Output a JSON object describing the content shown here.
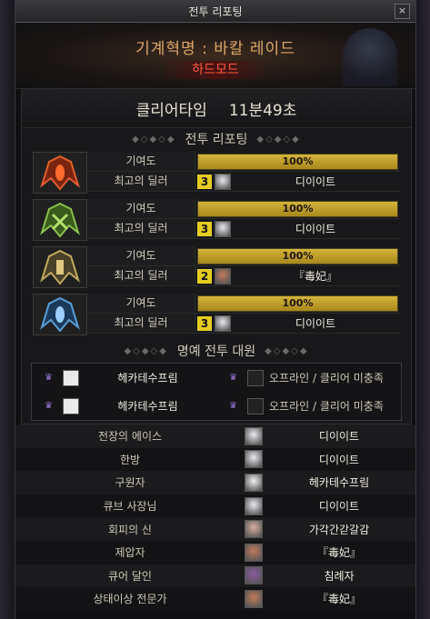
{
  "window": {
    "title": "전투 리포팅",
    "close_label": "×"
  },
  "banner": {
    "raid_name": "기계혁명 : 바칼 레이드",
    "mode": "하드모드"
  },
  "clear": {
    "label": "클리어타임",
    "time": "11분49초"
  },
  "report_section": {
    "title": "전투 리포팅",
    "ornament": "◆◇◆◇◆"
  },
  "contribution_rows": [
    {
      "emblem": "red-dragon-emblem-icon",
      "emblem_color": "#c0401c",
      "contrib_label": "기여도",
      "contrib_pct": "100%",
      "contrib_value": 1.0,
      "dealer_label": "최고의 딜러",
      "level": "3",
      "avatar_color": "#e8e8f0",
      "dealer_name": "디이이트"
    },
    {
      "emblem": "green-dragon-emblem-icon",
      "emblem_color": "#6aa03a",
      "contrib_label": "기여도",
      "contrib_pct": "100%",
      "contrib_value": 1.0,
      "dealer_label": "최고의 딜러",
      "level": "3",
      "avatar_color": "#e8e8f0",
      "dealer_name": "디이이트"
    },
    {
      "emblem": "gold-dragon-emblem-icon",
      "emblem_color": "#b09a50",
      "contrib_label": "기여도",
      "contrib_pct": "100%",
      "contrib_value": 1.0,
      "dealer_label": "최고의 딜러",
      "level": "2",
      "avatar_color": "#c07a5a",
      "dealer_name": "『毒妃』"
    },
    {
      "emblem": "blue-dragon-emblem-icon",
      "emblem_color": "#3a7ab0",
      "contrib_label": "기여도",
      "contrib_pct": "100%",
      "contrib_value": 1.0,
      "dealer_label": "최고의 딜러",
      "level": "3",
      "avatar_color": "#e8e8f0",
      "dealer_name": "디이이트"
    }
  ],
  "honor_section": {
    "title": "명예 전투 대원",
    "ornament": "◆◇◆◇◆"
  },
  "honor_rows": [
    {
      "left_name": "헤카테수프림",
      "right_status": "오프라인 / 클리어 미충족"
    },
    {
      "left_name": "헤카테수프림",
      "right_status": "오프라인 / 클리어 미충족"
    }
  ],
  "awards": [
    {
      "title": "전장의 에이스",
      "avatar_color": "#e8e8f0",
      "name": "디이이트"
    },
    {
      "title": "한방",
      "avatar_color": "#e8e8f0",
      "name": "디이이트"
    },
    {
      "title": "구원자",
      "avatar_color": "#f4f0f0",
      "name": "헤카테수프림"
    },
    {
      "title": "큐브 사장님",
      "avatar_color": "#e8e8f0",
      "name": "디이이트"
    },
    {
      "title": "회피의 신",
      "avatar_color": "#d8b0a0",
      "name": "가각간갇갈감"
    },
    {
      "title": "제압자",
      "avatar_color": "#c07a5a",
      "name": "『毒妃』"
    },
    {
      "title": "큐어 달인",
      "avatar_color": "#8a5aa0",
      "name": "침례자"
    },
    {
      "title": "상태이상 전문가",
      "avatar_color": "#c07a5a",
      "name": "『毒妃』"
    }
  ]
}
